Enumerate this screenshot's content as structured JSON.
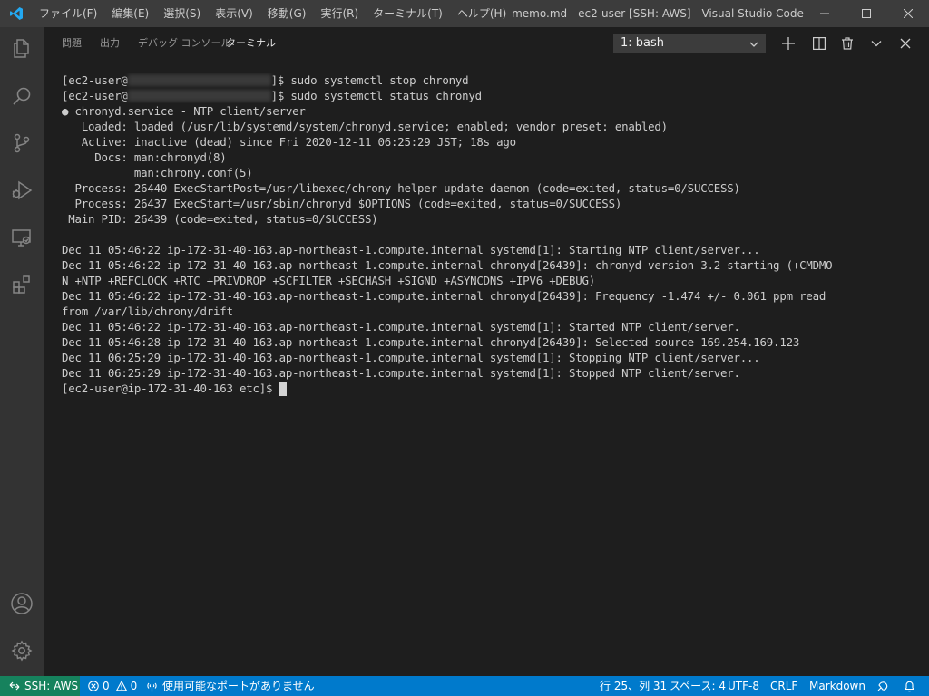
{
  "titlebar": {
    "menu": [
      "ファイル(F)",
      "編集(E)",
      "選択(S)",
      "表示(V)",
      "移動(G)",
      "実行(R)",
      "ターミナル(T)",
      "ヘルプ(H)"
    ],
    "title": "memo.md - ec2-user [SSH: AWS] - Visual Studio Code"
  },
  "activity_bar": {
    "icons": [
      "explorer-icon",
      "search-icon",
      "source-control-icon",
      "run-debug-icon",
      "remote-explorer-icon",
      "extensions-icon",
      "account-icon",
      "settings-gear-icon"
    ]
  },
  "panel": {
    "tabs": [
      "問題",
      "出力",
      "デバッグ コンソール",
      "ターミナル"
    ],
    "active_tab": "ターミナル",
    "terminal_selector": "1: bash"
  },
  "terminal": {
    "lines": [
      {
        "pre": "[ec2-user@",
        "redacted": true,
        "post": "]$ sudo systemctl stop chronyd"
      },
      {
        "pre": "[ec2-user@",
        "redacted": true,
        "post": "]$ sudo systemctl status chronyd"
      },
      {
        "text": "● chronyd.service - NTP client/server"
      },
      {
        "text": "   Loaded: loaded (/usr/lib/systemd/system/chronyd.service; enabled; vendor preset: enabled)"
      },
      {
        "text": "   Active: inactive (dead) since Fri 2020-12-11 06:25:29 JST; 18s ago"
      },
      {
        "text": "     Docs: man:chronyd(8)"
      },
      {
        "text": "           man:chrony.conf(5)"
      },
      {
        "text": "  Process: 26440 ExecStartPost=/usr/libexec/chrony-helper update-daemon (code=exited, status=0/SUCCESS)"
      },
      {
        "text": "  Process: 26437 ExecStart=/usr/sbin/chronyd $OPTIONS (code=exited, status=0/SUCCESS)"
      },
      {
        "text": " Main PID: 26439 (code=exited, status=0/SUCCESS)"
      },
      {
        "text": ""
      },
      {
        "text": "Dec 11 05:46:22 ip-172-31-40-163.ap-northeast-1.compute.internal systemd[1]: Starting NTP client/server..."
      },
      {
        "text": "Dec 11 05:46:22 ip-172-31-40-163.ap-northeast-1.compute.internal chronyd[26439]: chronyd version 3.2 starting (+CMDMO"
      },
      {
        "text": "N +NTP +REFCLOCK +RTC +PRIVDROP +SCFILTER +SECHASH +SIGND +ASYNCDNS +IPV6 +DEBUG)"
      },
      {
        "text": "Dec 11 05:46:22 ip-172-31-40-163.ap-northeast-1.compute.internal chronyd[26439]: Frequency -1.474 +/- 0.061 ppm read"
      },
      {
        "text": "from /var/lib/chrony/drift"
      },
      {
        "text": "Dec 11 05:46:22 ip-172-31-40-163.ap-northeast-1.compute.internal systemd[1]: Started NTP client/server."
      },
      {
        "text": "Dec 11 05:46:28 ip-172-31-40-163.ap-northeast-1.compute.internal chronyd[26439]: Selected source 169.254.169.123"
      },
      {
        "text": "Dec 11 06:25:29 ip-172-31-40-163.ap-northeast-1.compute.internal systemd[1]: Stopping NTP client/server..."
      },
      {
        "text": "Dec 11 06:25:29 ip-172-31-40-163.ap-northeast-1.compute.internal systemd[1]: Stopped NTP client/server."
      }
    ],
    "prompt": "[ec2-user@ip-172-31-40-163 etc]$ "
  },
  "statusbar": {
    "remote": "SSH: AWS",
    "errors": "0",
    "warnings": "0",
    "ports": "使用可能なポートがありません",
    "position": "行 25、列 31",
    "spaces": "スペース: 4",
    "encoding": "UTF-8",
    "eol": "CRLF",
    "language": "Markdown"
  },
  "colors": {
    "titlebar": "#3c3c3c",
    "activity_bar": "#333333",
    "editor_bg": "#1e1e1e",
    "statusbar": "#007acc",
    "remote_indicator": "#16825d"
  }
}
